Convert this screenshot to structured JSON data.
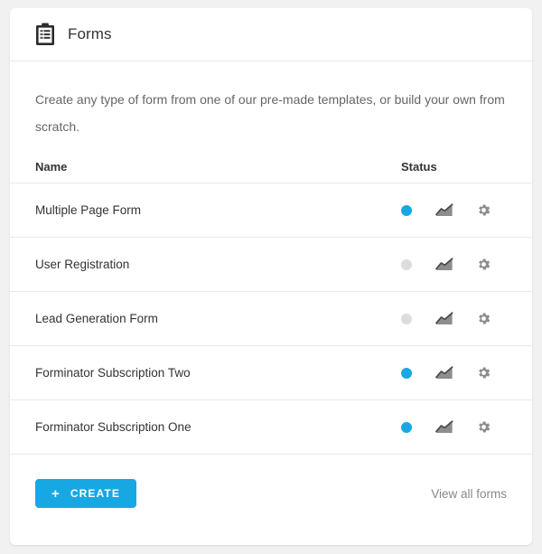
{
  "header": {
    "title": "Forms",
    "icon": "clipboard-icon"
  },
  "description": "Create any type of form from one of our pre-made templates, or build your own from scratch.",
  "table": {
    "columns": {
      "name": "Name",
      "status": "Status"
    },
    "rows": [
      {
        "name": "Multiple Page Form",
        "status": "active",
        "chart_icon": "chart-icon",
        "settings_icon": "gear-icon"
      },
      {
        "name": "User Registration",
        "status": "inactive",
        "chart_icon": "chart-icon",
        "settings_icon": "gear-icon"
      },
      {
        "name": "Lead Generation Form",
        "status": "inactive",
        "chart_icon": "chart-icon",
        "settings_icon": "gear-icon"
      },
      {
        "name": "Forminator Subscription Two",
        "status": "active",
        "chart_icon": "chart-icon",
        "settings_icon": "gear-icon"
      },
      {
        "name": "Forminator Subscription One",
        "status": "active",
        "chart_icon": "chart-icon",
        "settings_icon": "gear-icon"
      }
    ]
  },
  "footer": {
    "create_label": "CREATE",
    "create_icon": "plus-icon",
    "view_all_label": "View all forms"
  },
  "colors": {
    "accent": "#17a8e3",
    "status_active": "#17a8e3",
    "status_inactive": "#dddddd",
    "card_background": "#ffffff",
    "page_background": "#f1f1f1",
    "divider": "#eaeaea",
    "text_primary": "#333333",
    "text_secondary": "#666666",
    "text_muted": "#888888"
  }
}
